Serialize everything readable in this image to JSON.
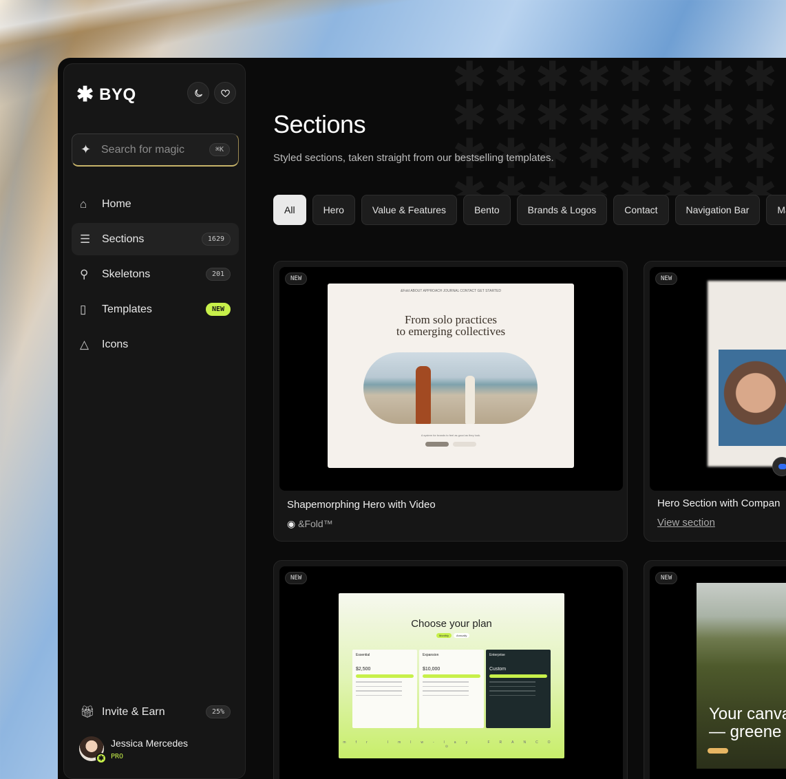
{
  "brand": {
    "name": "BYQ",
    "logo_glyph": "✱"
  },
  "header_icons": {
    "theme": "moon-icon",
    "favorites": "heart-icon"
  },
  "search": {
    "placeholder": "Search for magic",
    "shortcut": "⌘K"
  },
  "nav": [
    {
      "icon": "home-icon",
      "glyph": "⌂",
      "label": "Home",
      "badge": ""
    },
    {
      "icon": "layers-icon",
      "glyph": "☰",
      "label": "Sections",
      "badge": "1629",
      "active": true
    },
    {
      "icon": "bone-icon",
      "glyph": "⚲",
      "label": "Skeletons",
      "badge": "201"
    },
    {
      "icon": "book-icon",
      "glyph": "▯",
      "label": "Templates",
      "badge": "NEW"
    },
    {
      "icon": "shapes-icon",
      "glyph": "△",
      "label": "Icons",
      "badge": ""
    }
  ],
  "invite": {
    "label": "Invite & Earn",
    "badge": "25%"
  },
  "user": {
    "name": "Jessica Mercedes",
    "plan": "PRO"
  },
  "page": {
    "title": "Sections",
    "subtitle": "Styled sections, taken straight from our bestselling templates."
  },
  "filters": [
    "All",
    "Hero",
    "Value & Features",
    "Bento",
    "Brands & Logos",
    "Contact",
    "Navigation Bar",
    "Marq"
  ],
  "cards": [
    {
      "tag": "NEW",
      "title": "Shapemorphing Hero with Video",
      "author": "&Fold™",
      "preview": {
        "nav": "&Fold      ABOUT      APPROACH      JOURNAL      CONTACT      GET STARTED",
        "headline_1": "From solo practices",
        "headline_2": "to emerging collectives",
        "foot": "A system for brands to feel as good as they look."
      }
    },
    {
      "tag": "NEW",
      "title": "Hero Section with Compan",
      "link": "View section"
    },
    {
      "tag": "NEW",
      "preview": {
        "headline": "Choose your plan",
        "toggle": [
          "Monthly",
          "Annually"
        ],
        "plans": [
          {
            "name": "Essential",
            "price": "$2,500"
          },
          {
            "name": "Expansion",
            "price": "$10,000"
          },
          {
            "name": "Enterprise",
            "price": "Custom"
          }
        ],
        "logos": "mfr   lmlw-lay   FRANCO   ⊙"
      }
    },
    {
      "tag": "NEW",
      "preview": {
        "headline_1": "Your canva",
        "headline_2": "— greene"
      }
    }
  ],
  "colors": {
    "accent": "#c7f04a",
    "background": "#0b0b0b",
    "panel": "#161616"
  }
}
